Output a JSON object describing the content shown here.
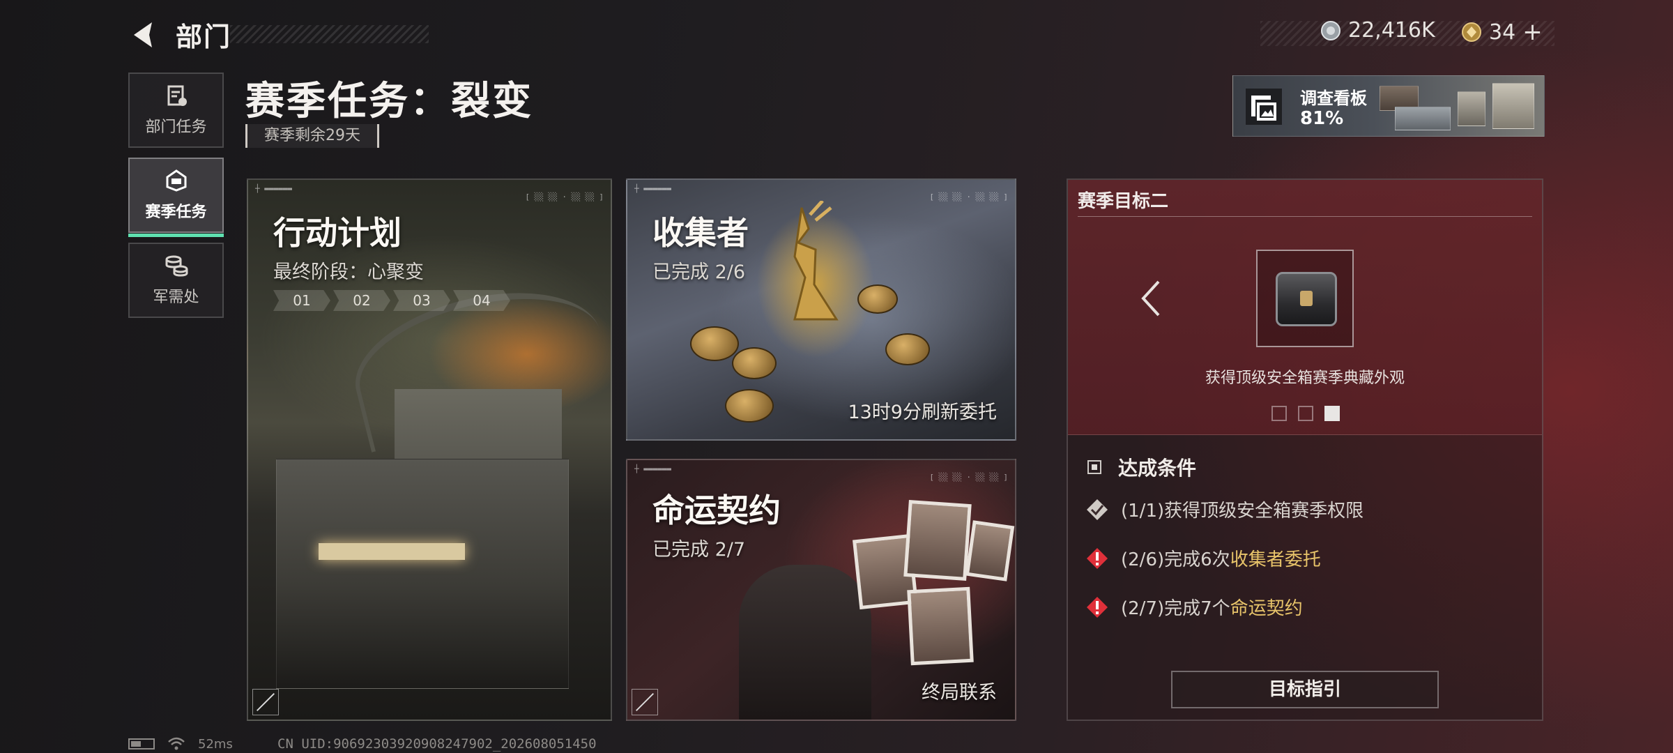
{
  "header": {
    "title": "部门",
    "currencies": [
      {
        "icon": "silver-coin-icon",
        "value": "22,416K"
      },
      {
        "icon": "gold-coin-icon",
        "value": "34"
      }
    ],
    "add_symbol": "+"
  },
  "sidebar": {
    "items": [
      {
        "label": "部门任务",
        "icon": "report-icon"
      },
      {
        "label": "赛季任务",
        "icon": "season-icon",
        "active": true
      },
      {
        "label": "军需处",
        "icon": "coins-stack-icon"
      }
    ]
  },
  "page": {
    "title": "赛季任务：裂变",
    "season_remaining": "赛季剩余29天"
  },
  "survey_board": {
    "label": "调查看板",
    "progress": "81%"
  },
  "cards": {
    "plan": {
      "title": "行动计划",
      "subtitle": "最终阶段：心聚变",
      "steps": [
        "01",
        "02",
        "03",
        "04"
      ]
    },
    "collector": {
      "title": "收集者",
      "progress": "已完成 2/6",
      "footer": "13时9分刷新委托"
    },
    "fate": {
      "title": "命运契约",
      "progress": "已完成 2/7",
      "footer": "终局联系"
    }
  },
  "goal_panel": {
    "heading": "赛季目标二",
    "reward_caption": "获得顶级安全箱赛季典藏外观",
    "pager_count": 3,
    "pager_active": 3,
    "conditions_heading": "达成条件",
    "conditions": [
      {
        "status": "done",
        "prefix": "(1/1)获得顶级安全箱赛季权限",
        "highlight": ""
      },
      {
        "status": "incomplete",
        "prefix": "(2/6)完成6次",
        "highlight": "收集者委托"
      },
      {
        "status": "incomplete",
        "prefix": "(2/7)完成7个",
        "highlight": "命运契约"
      }
    ],
    "guide_button": "目标指引"
  },
  "status_bar": {
    "ping": "52ms",
    "uid": "CN UID:90692303920908247902_202608051450"
  },
  "colors": {
    "accent_green": "#5fe0b0",
    "highlight_gold": "#e8c46a",
    "warning_red": "#e0303a"
  }
}
